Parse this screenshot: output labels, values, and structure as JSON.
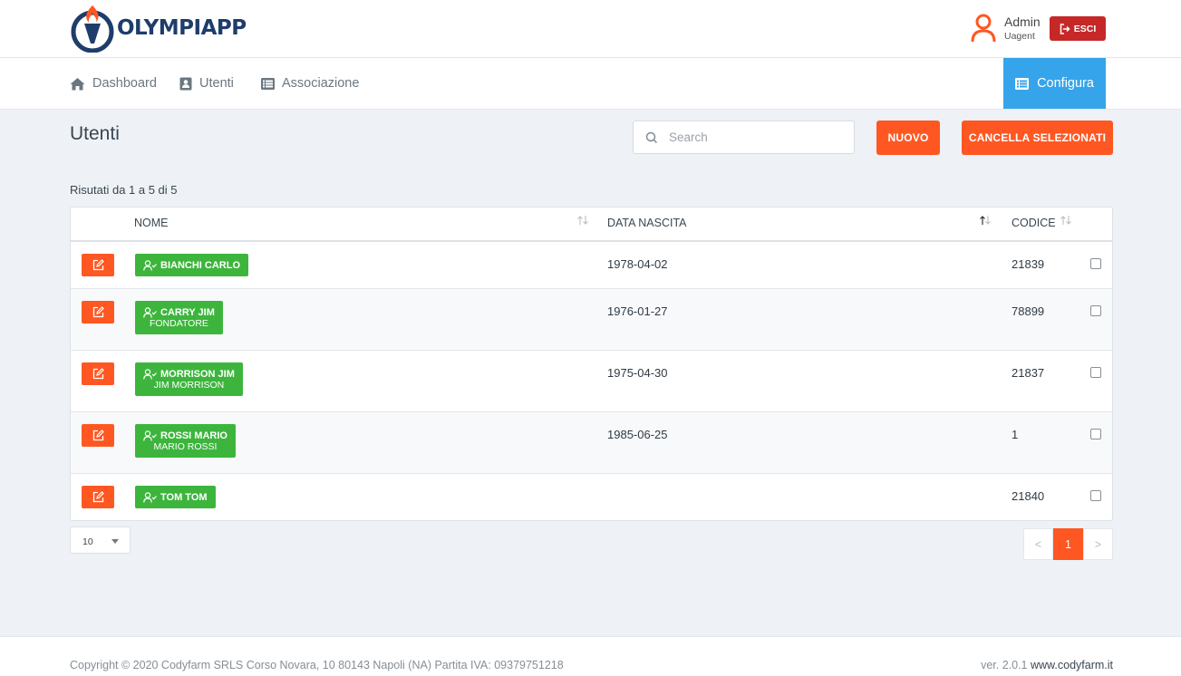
{
  "header": {
    "logo_text": "OLYMPIAPP",
    "user_name": "Admin",
    "user_role": "Uagent",
    "logout_label": "ESCI"
  },
  "nav": {
    "items": [
      {
        "label": "Dashboard",
        "icon": "home-icon"
      },
      {
        "label": "Utenti",
        "icon": "address-book-icon"
      },
      {
        "label": "Associazione",
        "icon": "list-icon"
      }
    ],
    "config_label": "Configura"
  },
  "main": {
    "title": "Utenti",
    "search_placeholder": "Search",
    "new_label": "NUOVO",
    "delete_selected_label": "CANCELLA SELEZIONATI",
    "results_text": "Risutati da 1 a 5 di 5"
  },
  "table": {
    "columns": [
      "NOME",
      "DATA NASCITA",
      "CODICE"
    ],
    "rows": [
      {
        "name": "BIANCHI CARLO",
        "sub": "",
        "birth": "1978-04-02",
        "code": "21839"
      },
      {
        "name": "CARRY JIM",
        "sub": "FONDATORE",
        "birth": "1976-01-27",
        "code": "78899"
      },
      {
        "name": "MORRISON JIM",
        "sub": "JIM MORRISON",
        "birth": "1975-04-30",
        "code": "21837"
      },
      {
        "name": "ROSSI MARIO",
        "sub": "MARIO ROSSI",
        "birth": "1985-06-25",
        "code": "1"
      },
      {
        "name": "TOM TOM",
        "sub": "",
        "birth": "",
        "code": "21840"
      }
    ]
  },
  "pagination": {
    "page_size": "10",
    "prev": "<",
    "current": "1",
    "next": ">"
  },
  "footer": {
    "copyright": "Copyright © 2020 Codyfarm SRLS Corso Novara, 10 80143 Napoli (NA) Partita IVA: 09379751218",
    "version": "ver. 2.0.1",
    "link": "www.codyfarm.it"
  },
  "colors": {
    "accent_orange": "#ff5722",
    "accent_blue": "#36a4ea",
    "badge_green": "#3db53d",
    "logout_red": "#c62828",
    "logo_navy": "#1e3d6b"
  }
}
